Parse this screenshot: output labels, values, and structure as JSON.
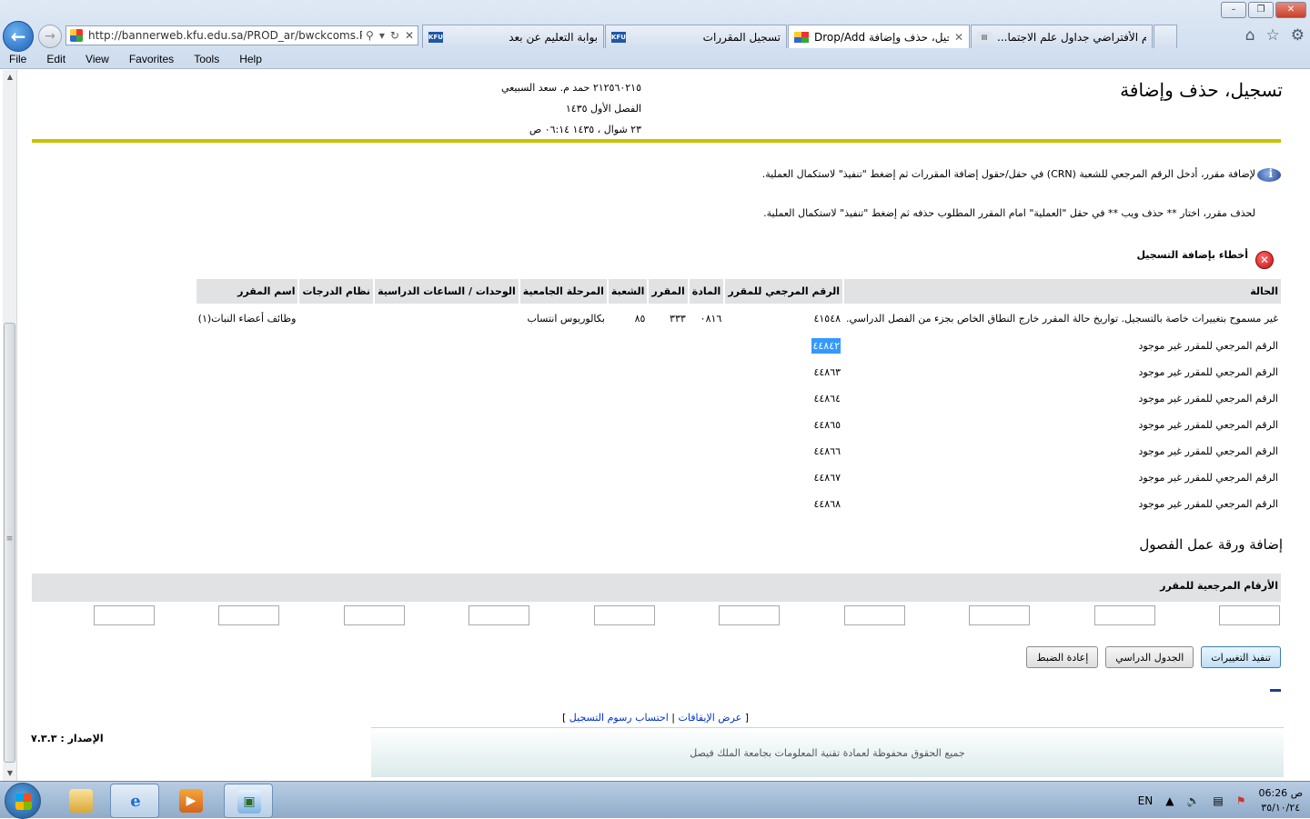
{
  "browser": {
    "url": "http://bannerweb.kfu.edu.sa/PROD_ar/bwckcoms.P_Re",
    "tabs": [
      {
        "label": "بوابة التعليم عن بعد",
        "active": false
      },
      {
        "label": "تسجيل المقررات",
        "active": false
      },
      {
        "label": "Drop/Add تسجيل، حذف وإضافة",
        "active": true
      },
      {
        "label": "...النظام الأفتراضي جداول علم الاجتما",
        "active": false
      }
    ],
    "menu": [
      "File",
      "Edit",
      "View",
      "Favorites",
      "Tools",
      "Help"
    ]
  },
  "page": {
    "title": "تسجيل، حذف وإضافة",
    "user_line": "٢١٢٥٦٠٢١٥ حمد م. سعد السبيعي",
    "term_line": "الفصل الأول ١٤٣٥",
    "date_line": "٢٣ شوال ، ١٤٣٥ ٠٦:١٤ ص",
    "instruction_add": "لإضافة مقرر، أدخل الرقم المرجعي للشعبة (CRN) في حقل/حقول إضافة المقررات ثم إضغط \"تنفيذ\" لاستكمال العملية.",
    "instruction_drop": "لحذف مقرر، اختار ** حذف ويب ** في حقل \"العملية\" امام المقرر المطلوب حذفه ثم إضغط \"تنفيذ\" لاستكمال العملية.",
    "errors_title": "أخطاء بإضافة التسجيل"
  },
  "errors_table": {
    "headers": [
      "الحالة",
      "الرقم المرجعي للمقرر",
      "المادة",
      "المقرر",
      "الشعبة",
      "المرحلة الجامعية",
      "الوحدات / الساعات الدراسية",
      "نظام الدرجات",
      "اسم المقرر"
    ],
    "rows": [
      {
        "status": "غير مسموح بتغييرات خاصة بالتسجيل. تواريخ حالة المقرر خارج النطاق الخاص بجزء من الفصل الدراسي.",
        "crn": "٤١٥٤٨",
        "subject": "٠٨١٦",
        "course": "٣٣٣",
        "section": "٨٥",
        "level": "بكالوريوس انتساب",
        "hours": "",
        "grade_mode": "",
        "title": "وظائف أعضاء النبات(١)"
      },
      {
        "status": "الرقم المرجعي للمقرر غير موجود",
        "crn": "٤٤٨٤٢",
        "highlight": true
      },
      {
        "status": "الرقم المرجعي للمقرر غير موجود",
        "crn": "٤٤٨٦٣"
      },
      {
        "status": "الرقم المرجعي للمقرر غير موجود",
        "crn": "٤٤٨٦٤"
      },
      {
        "status": "الرقم المرجعي للمقرر غير موجود",
        "crn": "٤٤٨٦٥"
      },
      {
        "status": "الرقم المرجعي للمقرر غير موجود",
        "crn": "٤٤٨٦٦"
      },
      {
        "status": "الرقم المرجعي للمقرر غير موجود",
        "crn": "٤٤٨٦٧"
      },
      {
        "status": "الرقم المرجعي للمقرر غير موجود",
        "crn": "٤٤٨٦٨"
      }
    ]
  },
  "worksheet": {
    "title": "إضافة ورقة عمل الفصول",
    "crn_header": "الأرقام المرجعية للمقرر",
    "inputs": [
      "",
      "",
      "",
      "",
      "",
      "",
      "",
      "",
      "",
      ""
    ]
  },
  "actions": {
    "submit": "تنفيذ التغييرات",
    "schedule": "الجدول الدراسي",
    "reset": "إعادة الضبط"
  },
  "footer": {
    "link_holds": "عرض الإيقافات",
    "link_fees": "احتساب رسوم التسجيل",
    "release_label": "الإصدار :",
    "release_value": "٧.٣.٣",
    "copyright": "جميع الحقوق محفوظة لعمادة تقنية المعلومات بجامعة الملك فيصل"
  },
  "taskbar": {
    "lang": "EN",
    "time": "06:26 ص",
    "date": "٣٥/١٠/٢٤"
  }
}
